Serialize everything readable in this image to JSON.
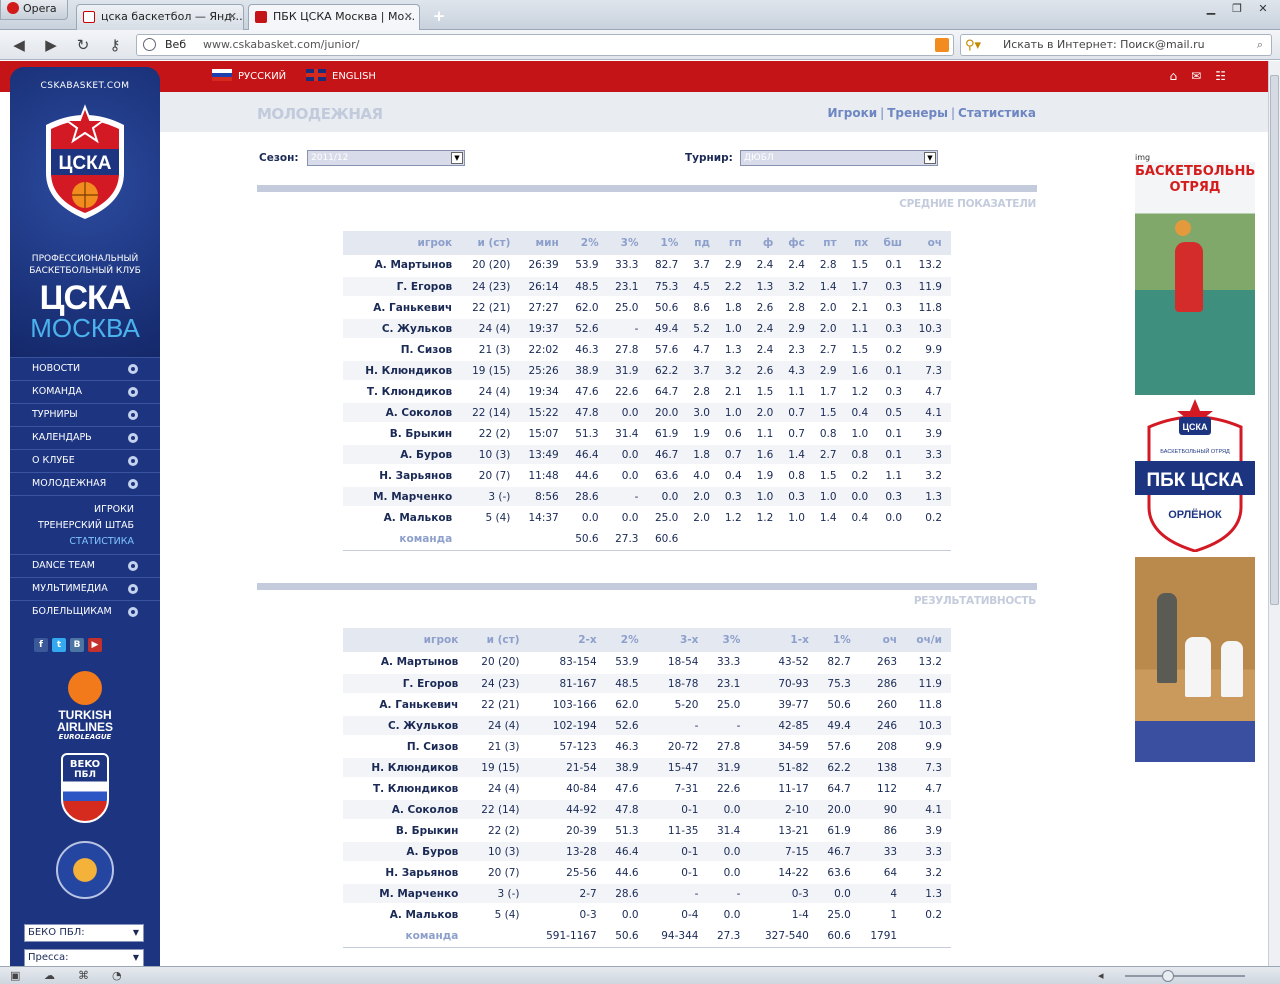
{
  "browser": {
    "app_label": "Opera",
    "tabs": [
      {
        "label": "цска баскетбол — Янд…"
      },
      {
        "label": "ПБК ЦСКА Москва | Мо…"
      }
    ],
    "address_web": "Веб",
    "address_url": "www.cskabasket.com/junior/",
    "search_placeholder": "Искать в Интернет: Поиск@mail.ru"
  },
  "topbar": {
    "lang_ru": "РУССКИЙ",
    "lang_en": "ENGLISH"
  },
  "sidebar": {
    "site_name": "CSKABASKET.COM",
    "crest_text": "ЦСКА",
    "club_desc_line1": "ПРОФЕССИОНАЛЬНЫЙ",
    "club_desc_line2": "БАСКЕТБОЛЬНЫЙ КЛУБ",
    "club_title": "ЦСКА",
    "club_city": "МОСКВА",
    "menu_items": [
      {
        "label": "НОВОСТИ"
      },
      {
        "label": "КОМАНДА"
      },
      {
        "label": "ТУРНИРЫ"
      },
      {
        "label": "КАЛЕНДАРЬ"
      },
      {
        "label": "О КЛУБЕ"
      },
      {
        "label": "МОЛОДЕЖНАЯ"
      }
    ],
    "submenu": [
      {
        "label": "ИГРОКИ"
      },
      {
        "label": "ТРЕНЕРСКИЙ ШТАБ"
      },
      {
        "label": "СТАТИСТИКА"
      }
    ],
    "menu_items_2": [
      {
        "label": "DANCE TEAM"
      },
      {
        "label": "МУЛЬТИМЕДИА"
      },
      {
        "label": "БОЛЕЛЬЩИКАМ"
      }
    ],
    "euroleague_line1": "TURKISH",
    "euroleague_line2": "AIRLINES",
    "euroleague_line3": "EUROLEAGUE",
    "beko_label": "BEKO",
    "beko_sub": "ПБЛ",
    "select1": "БЕКО ПБЛ:",
    "select2": "Пресса:"
  },
  "main": {
    "section_title": "МОЛОДЕЖНАЯ",
    "links": [
      "Игроки",
      "Тренеры",
      "Статистика"
    ],
    "season_label": "Сезон:",
    "season_value": "2011/12",
    "tournament_label": "Турнир:",
    "tournament_value": "ДЮБЛ",
    "table1_title": "СРЕДНИЕ ПОКАЗАТЕЛИ",
    "table1_headers": [
      "игрок",
      "и (ст)",
      "мин",
      "2%",
      "3%",
      "1%",
      "пд",
      "гп",
      "ф",
      "фс",
      "пт",
      "пх",
      "бш",
      "оч"
    ],
    "table1_rows": [
      [
        "А. Мартынов",
        "20 (20)",
        "26:39",
        "53.9",
        "33.3",
        "82.7",
        "3.7",
        "2.9",
        "2.4",
        "2.4",
        "2.8",
        "1.5",
        "0.1",
        "13.2"
      ],
      [
        "Г. Егоров",
        "24 (23)",
        "26:14",
        "48.5",
        "23.1",
        "75.3",
        "4.5",
        "2.2",
        "1.3",
        "3.2",
        "1.4",
        "1.7",
        "0.3",
        "11.9"
      ],
      [
        "А. Ганькевич",
        "22 (21)",
        "27:27",
        "62.0",
        "25.0",
        "50.6",
        "8.6",
        "1.8",
        "2.6",
        "2.8",
        "2.0",
        "2.1",
        "0.3",
        "11.8"
      ],
      [
        "С. Жульков",
        "24 (4)",
        "19:37",
        "52.6",
        "-",
        "49.4",
        "5.2",
        "1.0",
        "2.4",
        "2.9",
        "2.0",
        "1.1",
        "0.3",
        "10.3"
      ],
      [
        "П. Сизов",
        "21 (3)",
        "22:02",
        "46.3",
        "27.8",
        "57.6",
        "4.7",
        "1.3",
        "2.4",
        "2.3",
        "2.7",
        "1.5",
        "0.2",
        "9.9"
      ],
      [
        "Н. Клюндиков",
        "19 (15)",
        "25:26",
        "38.9",
        "31.9",
        "62.2",
        "3.7",
        "3.2",
        "2.6",
        "4.3",
        "2.9",
        "1.6",
        "0.1",
        "7.3"
      ],
      [
        "Т. Клюндиков",
        "24 (4)",
        "19:34",
        "47.6",
        "22.6",
        "64.7",
        "2.8",
        "2.1",
        "1.5",
        "1.1",
        "1.7",
        "1.2",
        "0.3",
        "4.7"
      ],
      [
        "А. Соколов",
        "22 (14)",
        "15:22",
        "47.8",
        "0.0",
        "20.0",
        "3.0",
        "1.0",
        "2.0",
        "0.7",
        "1.5",
        "0.4",
        "0.5",
        "4.1"
      ],
      [
        "В. Брыкин",
        "22 (2)",
        "15:07",
        "51.3",
        "31.4",
        "61.9",
        "1.9",
        "0.6",
        "1.1",
        "0.7",
        "0.8",
        "1.0",
        "0.1",
        "3.9"
      ],
      [
        "А. Буров",
        "10 (3)",
        "13:49",
        "46.4",
        "0.0",
        "46.7",
        "1.8",
        "0.7",
        "1.6",
        "1.4",
        "2.7",
        "0.8",
        "0.1",
        "3.3"
      ],
      [
        "Н. Зарьянов",
        "20 (7)",
        "11:48",
        "44.6",
        "0.0",
        "63.6",
        "4.0",
        "0.4",
        "1.9",
        "0.8",
        "1.5",
        "0.2",
        "1.1",
        "3.2"
      ],
      [
        "М. Марченко",
        "3 (-)",
        "8:56",
        "28.6",
        "-",
        "0.0",
        "2.0",
        "0.3",
        "1.0",
        "0.3",
        "1.0",
        "0.0",
        "0.3",
        "1.3"
      ],
      [
        "А. Мальков",
        "5 (4)",
        "14:37",
        "0.0",
        "0.0",
        "25.0",
        "2.0",
        "1.2",
        "1.2",
        "1.0",
        "1.4",
        "0.4",
        "0.0",
        "0.2"
      ]
    ],
    "table1_team": [
      "команда",
      "",
      "",
      "50.6",
      "27.3",
      "60.6",
      "",
      "",
      "",
      "",
      "",
      "",
      "",
      ""
    ],
    "table2_title": "РЕЗУЛЬТАТИВНОСТЬ",
    "table2_headers": [
      "игрок",
      "и (ст)",
      "2-х",
      "2%",
      "3-х",
      "3%",
      "1-х",
      "1%",
      "оч",
      "оч/и"
    ],
    "table2_rows": [
      [
        "А. Мартынов",
        "20 (20)",
        "83-154",
        "53.9",
        "18-54",
        "33.3",
        "43-52",
        "82.7",
        "263",
        "13.2"
      ],
      [
        "Г. Егоров",
        "24 (23)",
        "81-167",
        "48.5",
        "18-78",
        "23.1",
        "70-93",
        "75.3",
        "286",
        "11.9"
      ],
      [
        "А. Ганькевич",
        "22 (21)",
        "103-166",
        "62.0",
        "5-20",
        "25.0",
        "39-77",
        "50.6",
        "260",
        "11.8"
      ],
      [
        "С. Жульков",
        "24 (4)",
        "102-194",
        "52.6",
        "-",
        "-",
        "42-85",
        "49.4",
        "246",
        "10.3"
      ],
      [
        "П. Сизов",
        "21 (3)",
        "57-123",
        "46.3",
        "20-72",
        "27.8",
        "34-59",
        "57.6",
        "208",
        "9.9"
      ],
      [
        "Н. Клюндиков",
        "19 (15)",
        "21-54",
        "38.9",
        "15-47",
        "31.9",
        "51-82",
        "62.2",
        "138",
        "7.3"
      ],
      [
        "Т. Клюндиков",
        "24 (4)",
        "40-84",
        "47.6",
        "7-31",
        "22.6",
        "11-17",
        "64.7",
        "112",
        "4.7"
      ],
      [
        "А. Соколов",
        "22 (14)",
        "44-92",
        "47.8",
        "0-1",
        "0.0",
        "2-10",
        "20.0",
        "90",
        "4.1"
      ],
      [
        "В. Брыкин",
        "22 (2)",
        "20-39",
        "51.3",
        "11-35",
        "31.4",
        "13-21",
        "61.9",
        "86",
        "3.9"
      ],
      [
        "А. Буров",
        "10 (3)",
        "13-28",
        "46.4",
        "0-1",
        "0.0",
        "7-15",
        "46.7",
        "33",
        "3.3"
      ],
      [
        "Н. Зарьянов",
        "20 (7)",
        "25-56",
        "44.6",
        "0-1",
        "0.0",
        "14-22",
        "63.6",
        "64",
        "3.2"
      ],
      [
        "М. Марченко",
        "3 (-)",
        "2-7",
        "28.6",
        "-",
        "-",
        "0-3",
        "0.0",
        "4",
        "1.3"
      ],
      [
        "А. Мальков",
        "5 (4)",
        "0-3",
        "0.0",
        "0-4",
        "0.0",
        "1-4",
        "25.0",
        "1",
        "0.2"
      ]
    ],
    "table2_team": [
      "команда",
      "",
      "591-1167",
      "50.6",
      "94-344",
      "27.3",
      "327-540",
      "60.6",
      "1791",
      ""
    ]
  },
  "ads": {
    "img_label": "img",
    "ad1_line1": "БАСКЕТБОЛЬНЫЙ",
    "ad1_line2": "ОТРЯД",
    "ad2_top": "ЦСКА",
    "ad2_small": "БАСКЕТБОЛЬНЫЙ ОТРЯД",
    "ad2_main": "ПБК ЦСКА",
    "ad2_bottom": "ОРЛЁНОК"
  },
  "colors": {
    "brand_red": "#c41417",
    "sidebar_blue": "#1d3580",
    "accent_light_blue": "#4ab3ee",
    "header_text": "#8d9fcb"
  }
}
